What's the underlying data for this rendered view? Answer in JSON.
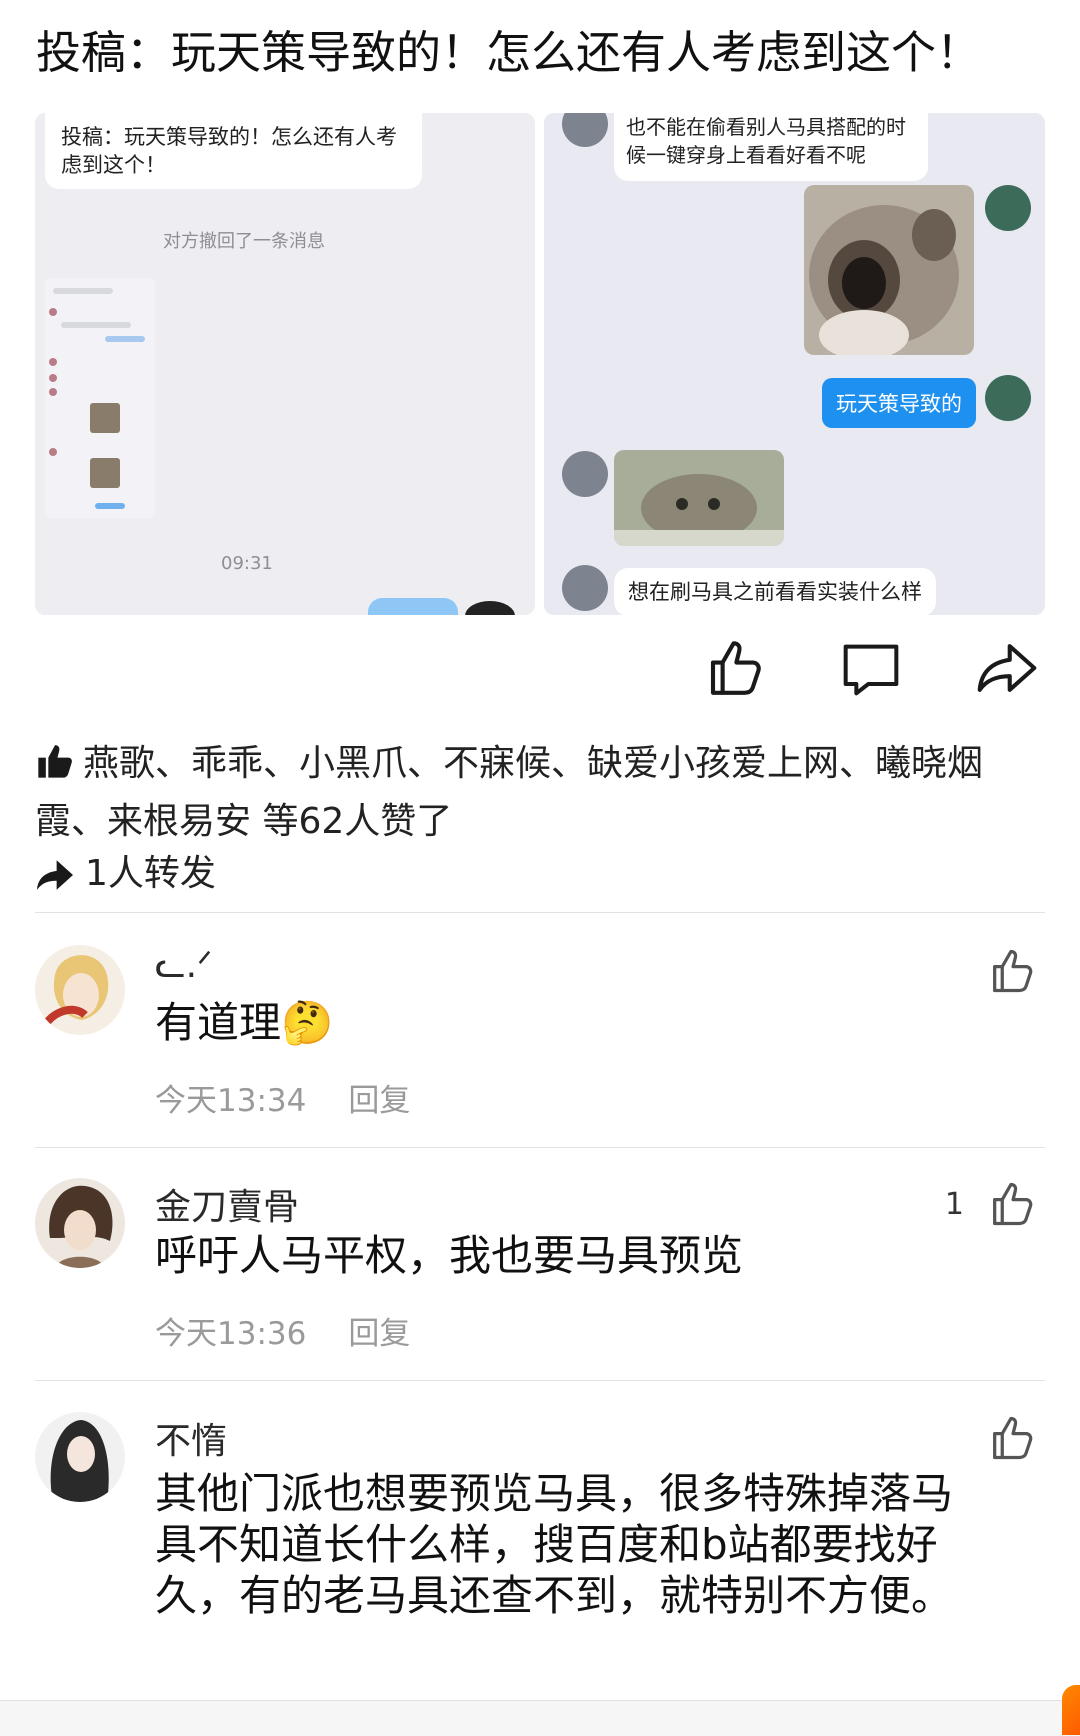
{
  "post": {
    "title": "投稿：玩天策导致的！怎么还有人考虑到这个！"
  },
  "left_image": {
    "bubble_text": "投稿：玩天策导致的！怎么还有人考虑到这个！",
    "system_text": "对方撤回了一条消息",
    "time": "09:31"
  },
  "right_image": {
    "top_bubble": "也不能在偷看别人马具搭配的时候一键穿身上看看好看不呢",
    "blue_bubble": "玩天策导致的",
    "bottom_bubble": "想在刷马具之前看看实装什么样"
  },
  "actions": {
    "like_icon": "thumbs-up-icon",
    "comment_icon": "comment-icon",
    "share_icon": "share-icon"
  },
  "likes": {
    "text": "燕歌、乖乖、小黑爪、不寐候、缺爱小孩爱上网、曦晓烟霞、来根易安 等62人赞了"
  },
  "forwards": {
    "text": "1人转发"
  },
  "comments": [
    {
      "name": "ᓚ.ᐟ",
      "text": "有道理🤔",
      "time": "今天13:34",
      "reply": "回复",
      "likes": ""
    },
    {
      "name": "金刀賣骨",
      "text": "呼吁人马平权，我也要马具预览",
      "time": "今天13:36",
      "reply": "回复",
      "likes": "1"
    },
    {
      "name": "不惰",
      "text": "其他门派也想要预览马具，很多特殊掉落马具不知道长什么样，搜百度和b站都要找好久，有的老马具还查不到，就特别不方便。",
      "time": "",
      "reply": "",
      "likes": ""
    }
  ],
  "colors": {
    "accent_blue": "#1e90f0",
    "meta_gray": "#9a9a9a",
    "orange": "#ff6a00"
  }
}
